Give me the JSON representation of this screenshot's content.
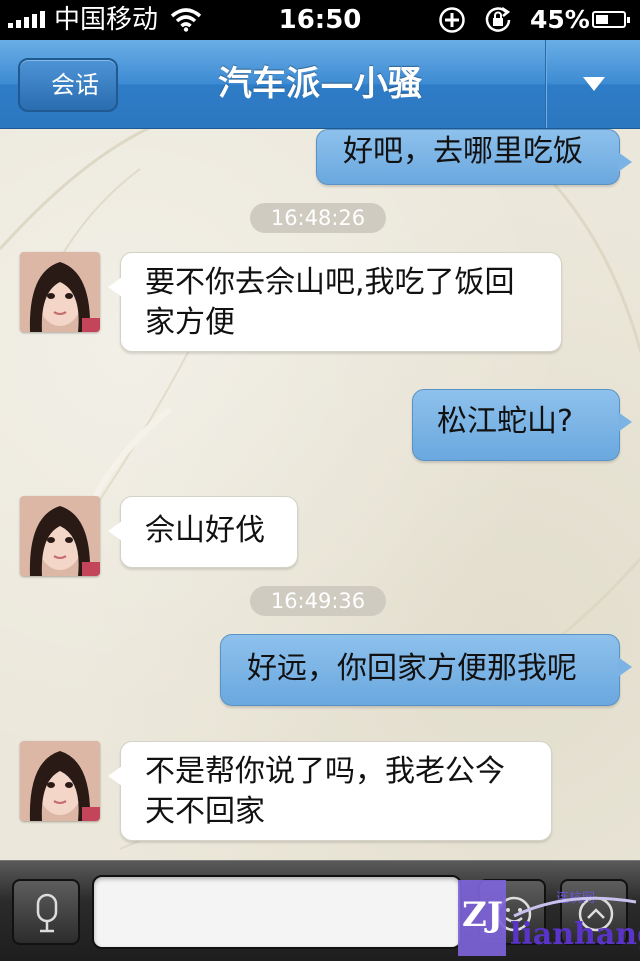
{
  "status_bar": {
    "carrier": "中国移动",
    "time": "16:50",
    "battery_percent": "45%",
    "battery_level": 0.45,
    "icons": [
      "signal-icon",
      "wifi-icon",
      "add-circle-icon",
      "rotation-lock-icon",
      "battery-icon"
    ]
  },
  "nav": {
    "back_label": "会话",
    "title": "汽车派—小骚",
    "menu_icon": "triangle-down-icon"
  },
  "messages": [
    {
      "side": "right",
      "text": "好吧，去哪里吃饭"
    },
    {
      "timestamp": "16:48:26"
    },
    {
      "side": "left",
      "line1": "要不你去佘山吧,我吃了饭回",
      "line2": "家方便"
    },
    {
      "side": "right",
      "text": "松江蛇山?"
    },
    {
      "side": "left",
      "text": "佘山好伐"
    },
    {
      "timestamp": "16:49:36"
    },
    {
      "side": "right",
      "text": "好远，你回家方便那我呢"
    },
    {
      "side": "left",
      "line1": "不是帮你说了吗，我老公今",
      "line2": "天不回家"
    }
  ],
  "input_bar": {
    "voice_icon": "microphone-icon",
    "emoji_icon": "emoji-icon",
    "more_icon": "chevron-up-circle-icon",
    "input_value": ""
  },
  "watermark": {
    "text_main": "ZJ",
    "text_sub": "lianhang",
    "text_cn": "连杭网"
  },
  "colors": {
    "nav_blue": "#3d8bd3",
    "bubble_blue": "#7ab3e4",
    "bubble_white": "#ffffff",
    "chat_bg": "#ebe7da",
    "timestamp_bg": "#cfcbc0"
  }
}
